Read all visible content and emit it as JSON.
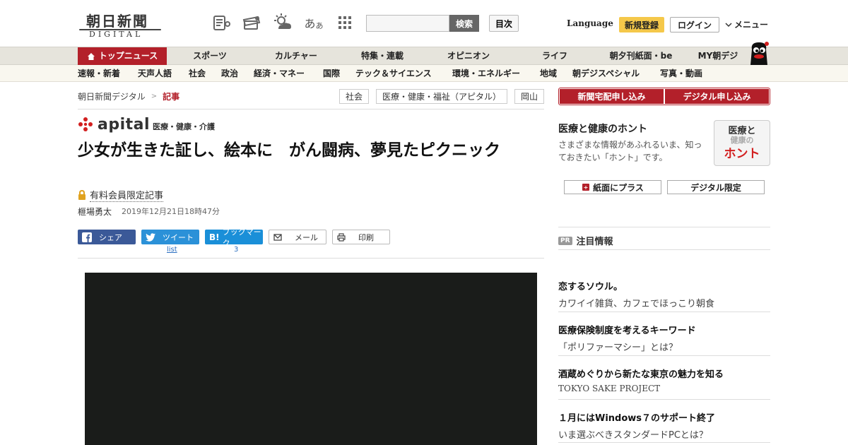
{
  "header": {
    "logo_main": "朝日新聞",
    "logo_sub": "DIGITAL",
    "search_button": "検索",
    "search_placeholder": "",
    "toc_button": "目次",
    "language": "Language",
    "register": "新規登録",
    "login": "ログイン",
    "menu": "メニュー",
    "font_size_glyph_large": "あ",
    "font_size_glyph_small": "あ"
  },
  "nav": {
    "top_news": "トップニュース",
    "items": [
      "スポーツ",
      "カルチャー",
      "特集・連載",
      "オピニオン",
      "ライフ",
      "朝夕刊紙面・be",
      "MY朝デジ"
    ]
  },
  "subnav": {
    "items": [
      "速報・新着",
      "天声人語",
      "社会",
      "政治",
      "経済・マネー",
      "国際",
      "テック＆サイエンス",
      "環境・エネルギー",
      "地域",
      "朝デジスペシャル",
      "写真・動画"
    ]
  },
  "breadcrumb": {
    "home": "朝日新聞デジタル",
    "separator": ">",
    "current": "記事"
  },
  "tags": [
    "社会",
    "医療・健康・福祉（アピタル）",
    "岡山"
  ],
  "article": {
    "brand": "apital",
    "brand_sub": "医療・健康・介護",
    "headline": "少女が生きた証し、絵本に　がん闘病、夢見たピクニック",
    "paid_label": "有料会員限定記事",
    "author": "榧場勇太",
    "date": "2019年12月21日18時47分"
  },
  "share": {
    "facebook": "シェア",
    "twitter": "ツイート",
    "hatena": "ブックマーク",
    "mail": "メール",
    "print": "印刷",
    "twitter_count": "list",
    "hatena_count": "3"
  },
  "sidebar": {
    "subscribe_paper": "新聞宅配申し込み",
    "subscribe_digital": "デジタル申し込み",
    "honto_title": "医療と健康のホント",
    "honto_desc": "さまざまな情報があふれるいま、知っておきたい「ホント」です。",
    "honto_badge_1": "医療と",
    "honto_badge_2": "健康の",
    "honto_badge_3": "ホント",
    "paper_plus": "紙面にプラス",
    "digital_only": "デジタル限定",
    "pr_badge": "PR",
    "pr_header": "注目情報",
    "pr_items": [
      {
        "title": "恋するソウル。",
        "sub": "カワイイ雑貨、カフェでほっこり朝食"
      },
      {
        "title": "医療保険制度を考えるキーワード",
        "sub": "「ポリファーマシー」とは？"
      },
      {
        "title": "酒蔵めぐりから新たな東京の魅力を知る",
        "sub": "TOKYO SAKE PROJECT"
      },
      {
        "title": "１月にはWindows７のサポート終了",
        "sub": "いま選ぶべきスタンダードPCとは？"
      }
    ]
  },
  "colors": {
    "brand_red": "#b3202a",
    "nav_bg": "#e6e4dc",
    "register_yellow": "#f5c84a",
    "facebook": "#3b5998",
    "twitter": "#2b91d8"
  }
}
